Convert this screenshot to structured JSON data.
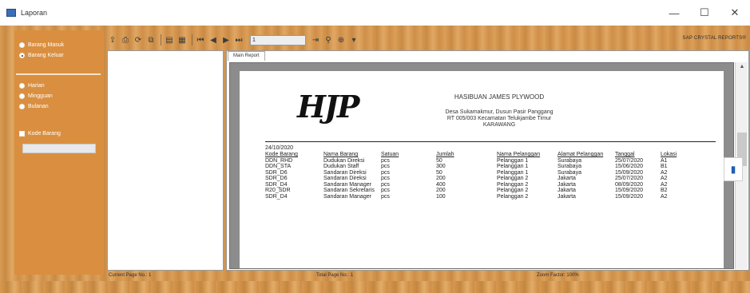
{
  "window": {
    "title": "Laporan",
    "minimize": "—",
    "maximize": "☐",
    "close": "✕"
  },
  "left_panel": {
    "radio_group_1": [
      {
        "label": "Barang Masuk",
        "checked": false
      },
      {
        "label": "Barang Keluar",
        "checked": true
      }
    ],
    "radio_group_2": [
      {
        "label": "Harian",
        "checked": false
      },
      {
        "label": "Mingguan",
        "checked": false
      },
      {
        "label": "Bulanan",
        "checked": false
      }
    ],
    "checkbox_label": "Kode Barang",
    "textbox_value": ""
  },
  "toolbar": {
    "page_value": "1",
    "brand": "SAP CRYSTAL REPORTS®"
  },
  "viewer": {
    "tab_label": "Main Report"
  },
  "report": {
    "logo_text": "HJP",
    "company": "HASIBUAN JAMES PLYWOOD",
    "address_line1": "Desa Sukamakmur, Dusun Pasir Panggang",
    "address_line2": "RT 005/003 Kecamatan Telukjambe Timur",
    "address_line3": "KARAWANG",
    "date": "24/10/2020",
    "columns": [
      "Kode Barang",
      "Nama Barang",
      "Satuan",
      "Jumlah",
      "Nama Pelanggan",
      "Alamat Pelanggan",
      "Tanggal",
      "Lokasi"
    ],
    "rows": [
      [
        "DDN_RHD",
        "Dudukan Direksi",
        "pcs",
        "50",
        "Pelanggan 1",
        "Surabaya",
        "25/07/2020",
        "A1"
      ],
      [
        "DDN_STA",
        "Dudukan Staff",
        "pcs",
        "300",
        "Pelanggan 1",
        "Surabaya",
        "15/06/2020",
        "B1"
      ],
      [
        "SDR_D6",
        "Sandaran Direksi",
        "pcs",
        "50",
        "Pelanggan 1",
        "Surabaya",
        "15/09/2020",
        "A2"
      ],
      [
        "SDR_D6",
        "Sandaran Direksi",
        "pcs",
        "200",
        "Pelanggan 2",
        "Jakarta",
        "25/07/2020",
        "A2"
      ],
      [
        "SDR_D4",
        "Sandaran Manager",
        "pcs",
        "400",
        "Pelanggan 2",
        "Jakarta",
        "08/09/2020",
        "A2"
      ],
      [
        "R20_SDR",
        "Sandaran Sekretaris",
        "pcs",
        "200",
        "Pelanggan 2",
        "Jakarta",
        "15/09/2020",
        "B2"
      ],
      [
        "SDR_D4",
        "Sandaran Manager",
        "pcs",
        "100",
        "Pelanggan 2",
        "Jakarta",
        "15/09/2020",
        "A2"
      ]
    ]
  },
  "status": {
    "current_page": "Current Page No.: 1",
    "total_page": "Total Page No.: 1",
    "zoom": "Zoom Factor: 100%"
  }
}
